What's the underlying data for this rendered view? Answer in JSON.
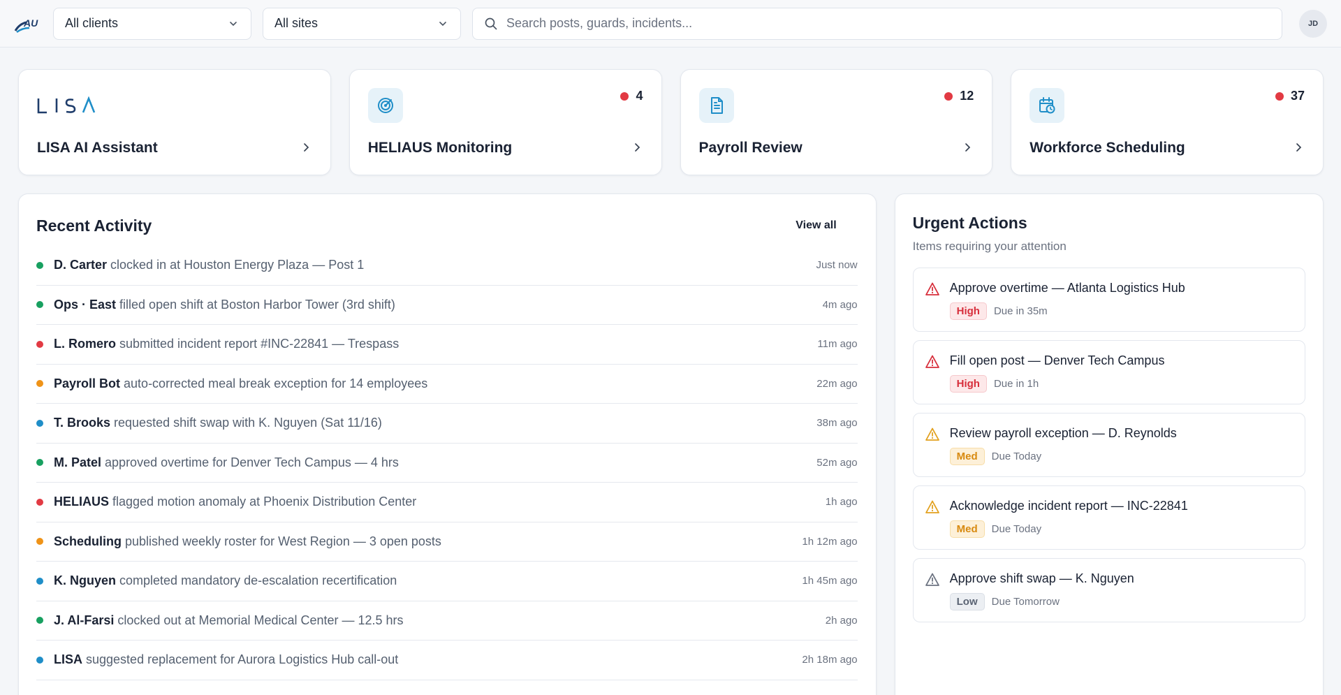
{
  "header": {
    "logo_text": "AU",
    "clients_select": "All clients",
    "sites_select": "All sites",
    "search_placeholder": "Search posts, guards, incidents...",
    "avatar_initials": "JD"
  },
  "cards": [
    {
      "title": "LISA AI Assistant",
      "logo_text": "LISA",
      "icon": "lisa-logo",
      "count": null
    },
    {
      "title": "HELIAUS Monitoring",
      "icon": "radar-icon",
      "count": "4"
    },
    {
      "title": "Payroll Review",
      "icon": "document-icon",
      "count": "12"
    },
    {
      "title": "Workforce Scheduling",
      "icon": "calendar-clock-icon",
      "count": "37"
    }
  ],
  "activity": {
    "title": "Recent Activity",
    "view_all": "View all",
    "items": [
      {
        "actor": "D. Carter",
        "text": "clocked in at Houston Energy Plaza — Post 1",
        "time": "Just now",
        "status": "green"
      },
      {
        "actor": "Ops · East",
        "text": "filled open shift at Boston Harbor Tower (3rd shift)",
        "time": "4m ago",
        "status": "green"
      },
      {
        "actor": "L. Romero",
        "text": "submitted incident report #INC-22841 — Trespass",
        "time": "11m ago",
        "status": "red"
      },
      {
        "actor": "Payroll Bot",
        "text": "auto-corrected meal break exception for 14 employees",
        "time": "22m ago",
        "status": "orange"
      },
      {
        "actor": "T. Brooks",
        "text": "requested shift swap with K. Nguyen (Sat 11/16)",
        "time": "38m ago",
        "status": "blue"
      },
      {
        "actor": "M. Patel",
        "text": "approved overtime for Denver Tech Campus — 4 hrs",
        "time": "52m ago",
        "status": "green"
      },
      {
        "actor": "HELIAUS",
        "text": "flagged motion anomaly at Phoenix Distribution Center",
        "time": "1h ago",
        "status": "red"
      },
      {
        "actor": "Scheduling",
        "text": "published weekly roster for West Region — 3 open posts",
        "time": "1h 12m ago",
        "status": "orange"
      },
      {
        "actor": "K. Nguyen",
        "text": "completed mandatory de-escalation recertification",
        "time": "1h 45m ago",
        "status": "blue"
      },
      {
        "actor": "J. Al-Farsi",
        "text": "clocked out at Memorial Medical Center — 12.5 hrs",
        "time": "2h ago",
        "status": "green"
      },
      {
        "actor": "LISA",
        "text": "suggested replacement for Aurora Logistics Hub call-out",
        "time": "2h 18m ago",
        "status": "blue"
      }
    ]
  },
  "urgent": {
    "title": "Urgent Actions",
    "subtitle": "Items requiring your attention",
    "items": [
      {
        "title": "Approve overtime — Atlanta Logistics Hub",
        "priority": "High",
        "level": "high",
        "due": "Due in 35m",
        "icon_color": "#d72e3b"
      },
      {
        "title": "Fill open post — Denver Tech Campus",
        "priority": "High",
        "level": "high",
        "due": "Due in 1h",
        "icon_color": "#d72e3b"
      },
      {
        "title": "Review payroll exception — D. Reynolds",
        "priority": "Med",
        "level": "med",
        "due": "Due Today",
        "icon_color": "#e2a11f"
      },
      {
        "title": "Acknowledge incident report — INC-22841",
        "priority": "Med",
        "level": "med",
        "due": "Due Today",
        "icon_color": "#e2a11f"
      },
      {
        "title": "Approve shift swap — K. Nguyen",
        "priority": "Low",
        "level": "low",
        "due": "Due Tomorrow",
        "icon_color": "#6b7280"
      }
    ]
  },
  "colors": {
    "accent": "#1f8ec8",
    "brand_navy": "#1f3d6b",
    "alert_red": "#e23a43"
  }
}
